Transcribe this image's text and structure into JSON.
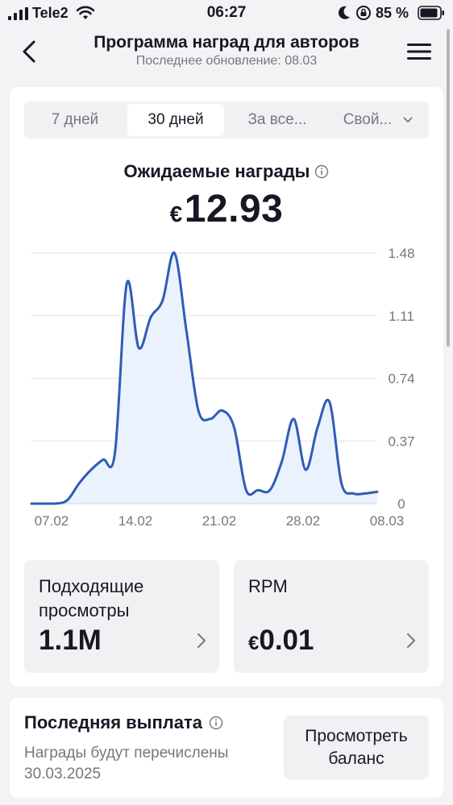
{
  "status_bar": {
    "carrier": "Tele2",
    "time": "06:27",
    "battery_percent": "85 %"
  },
  "header": {
    "title": "Программа наград для авторов",
    "subtitle": "Последнее обновление: 08.03",
    "icons": [
      "chevron-left-icon",
      "hamburger-menu-icon"
    ]
  },
  "tabs": [
    {
      "label": "7 дней",
      "active": false
    },
    {
      "label": "30 дней",
      "active": true
    },
    {
      "label": "За все...",
      "active": false
    },
    {
      "label": "Свой...",
      "active": false
    }
  ],
  "rewards": {
    "label": "Ожидаемые награды",
    "currency": "€",
    "value": "12.93"
  },
  "chart_data": {
    "type": "area",
    "x_labels": [
      "07.02",
      "14.02",
      "21.02",
      "28.02",
      "08.03"
    ],
    "y_ticks": [
      "0",
      "0.37",
      "0.74",
      "1.11",
      "1.48"
    ],
    "ylim": [
      0,
      1.48
    ],
    "x_days": [
      0,
      1,
      2,
      3,
      4,
      5,
      6,
      7,
      8,
      9,
      10,
      11,
      12,
      13,
      14,
      15,
      16,
      17,
      18,
      19,
      20,
      21,
      22,
      23,
      24,
      25,
      26,
      27,
      28,
      29
    ],
    "values": [
      0,
      0,
      0,
      0.02,
      0.12,
      0.2,
      0.26,
      0.3,
      1.3,
      0.92,
      1.1,
      1.2,
      1.48,
      1.02,
      0.55,
      0.5,
      0.55,
      0.45,
      0.08,
      0.08,
      0.08,
      0.25,
      0.5,
      0.2,
      0.45,
      0.6,
      0.12,
      0.06,
      0.06,
      0.07
    ],
    "series_color": "#2f5cb8",
    "fill_color": "#eaf2fd",
    "grid": true
  },
  "stats": {
    "views": {
      "label": "Подходящие просмотры",
      "value": "1.1M"
    },
    "rpm": {
      "label": "RPM",
      "currency": "€",
      "value": "0.01"
    }
  },
  "payout": {
    "title": "Последняя выплата",
    "description": "Награды будут перечислены 30.03.2025",
    "button_label": "Просмотреть баланс"
  }
}
